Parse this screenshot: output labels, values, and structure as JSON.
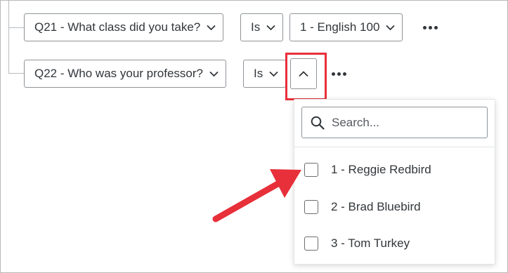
{
  "conditions": [
    {
      "question": "Q21 - What class did you take?",
      "operator": "Is",
      "value": "1 - English 100"
    },
    {
      "question": "Q22 - Who was your professor?",
      "operator": "Is"
    }
  ],
  "dropdown": {
    "search_placeholder": "Search...",
    "options": [
      "1 - Reggie Redbird",
      "2 - Brad Bluebird",
      "3 - Tom Turkey"
    ]
  },
  "colors": {
    "highlight": "#e7303a",
    "arrow": "#e7303a"
  },
  "icons": [
    "chevron-down-icon",
    "chevron-up-icon",
    "more-options-icon",
    "search-icon",
    "checkbox-icon",
    "pointer-arrow-icon"
  ]
}
